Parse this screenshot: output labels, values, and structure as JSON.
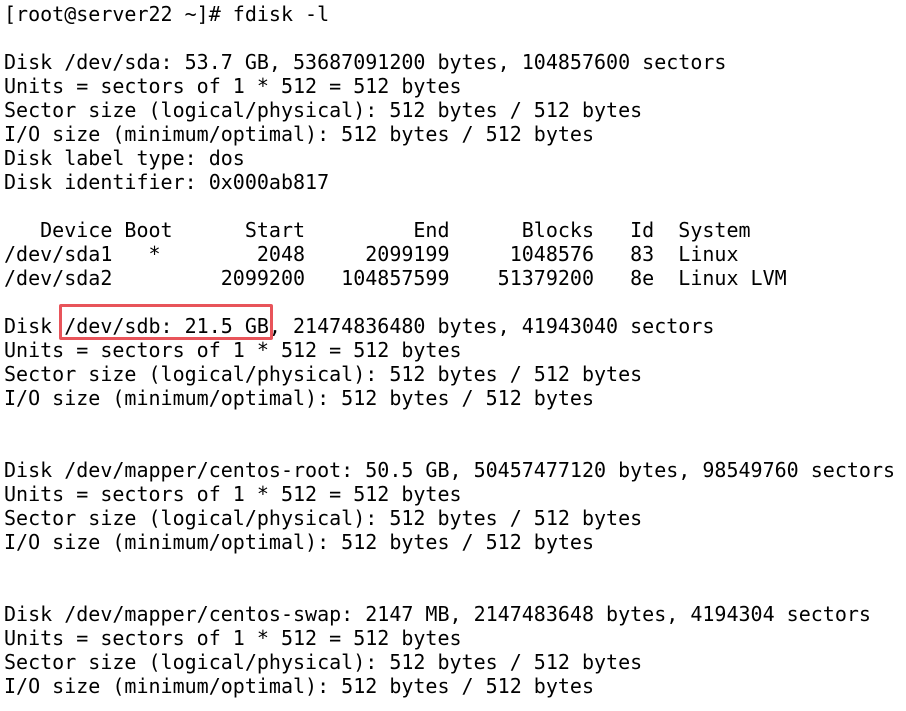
{
  "terminal": {
    "prompt_line": "[root@server22 ~]# fdisk -l",
    "sda": {
      "header": "Disk /dev/sda: 53.7 GB, 53687091200 bytes, 104857600 sectors",
      "units": "Units = sectors of 1 * 512 = 512 bytes",
      "sector_size": "Sector size (logical/physical): 512 bytes / 512 bytes",
      "io_size": "I/O size (minimum/optimal): 512 bytes / 512 bytes",
      "label_type": "Disk label type: dos",
      "identifier": "Disk identifier: 0x000ab817"
    },
    "partition_table": {
      "header_row": "   Device Boot      Start         End      Blocks   Id  System",
      "rows": [
        "/dev/sda1   *        2048     2099199     1048576   83  Linux",
        "/dev/sda2         2099200   104857599    51379200   8e  Linux LVM"
      ]
    },
    "sdb": {
      "header": "Disk /dev/sdb: 21.5 GB, 21474836480 bytes, 41943040 sectors",
      "units": "Units = sectors of 1 * 512 = 512 bytes",
      "sector_size": "Sector size (logical/physical): 512 bytes / 512 bytes",
      "io_size": "I/O size (minimum/optimal): 512 bytes / 512 bytes"
    },
    "centos_root": {
      "header": "Disk /dev/mapper/centos-root: 50.5 GB, 50457477120 bytes, 98549760 sectors",
      "units": "Units = sectors of 1 * 512 = 512 bytes",
      "sector_size": "Sector size (logical/physical): 512 bytes / 512 bytes",
      "io_size": "I/O size (minimum/optimal): 512 bytes / 512 bytes"
    },
    "centos_swap": {
      "header": "Disk /dev/mapper/centos-swap: 2147 MB, 2147483648 bytes, 4194304 sectors",
      "units": "Units = sectors of 1 * 512 = 512 bytes",
      "sector_size": "Sector size (logical/physical): 512 bytes / 512 bytes",
      "io_size": "I/O size (minimum/optimal): 512 bytes / 512 bytes"
    },
    "colors": {
      "background": "#ffffff",
      "text": "#000000",
      "highlight": "#e8545a"
    }
  }
}
